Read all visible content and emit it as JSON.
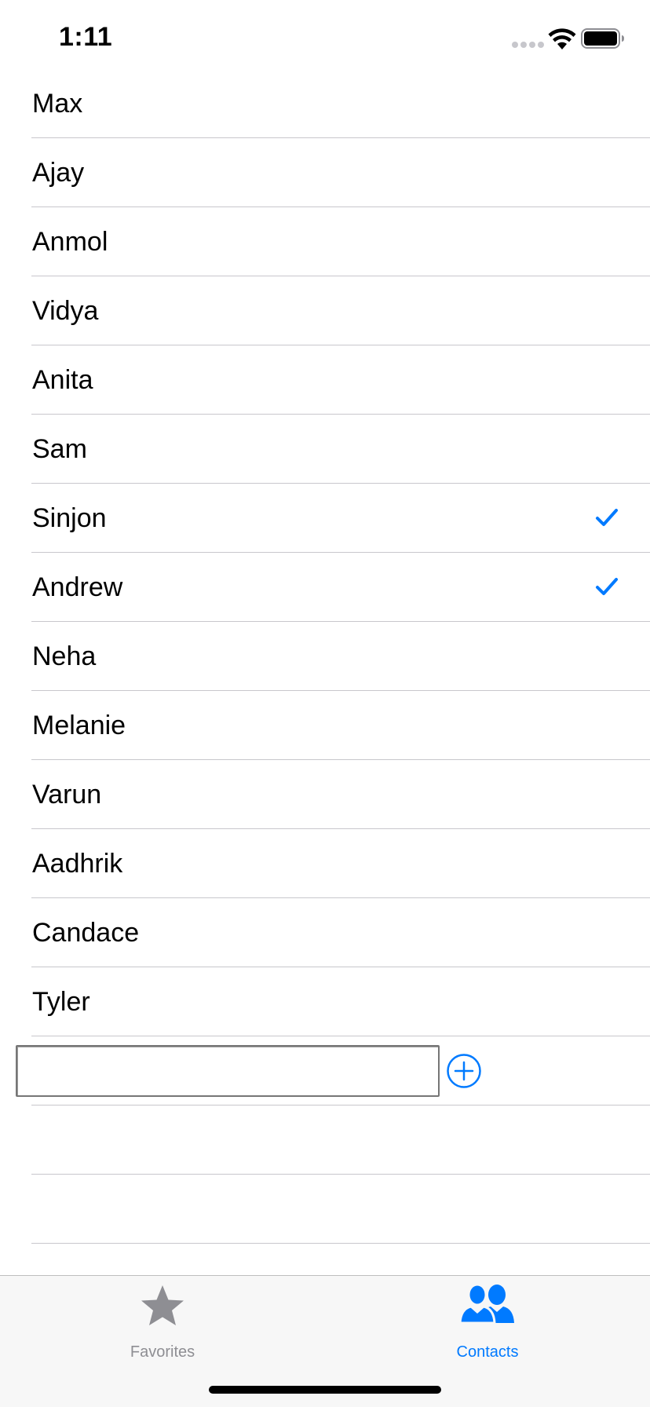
{
  "status_bar": {
    "time": "1:11"
  },
  "contacts": [
    {
      "name": "Max",
      "checked": false
    },
    {
      "name": "Ajay",
      "checked": false
    },
    {
      "name": "Anmol",
      "checked": false
    },
    {
      "name": "Vidya",
      "checked": false
    },
    {
      "name": "Anita",
      "checked": false
    },
    {
      "name": "Sam",
      "checked": false
    },
    {
      "name": "Sinjon",
      "checked": true
    },
    {
      "name": "Andrew",
      "checked": true
    },
    {
      "name": "Neha",
      "checked": false
    },
    {
      "name": "Melanie",
      "checked": false
    },
    {
      "name": "Varun",
      "checked": false
    },
    {
      "name": "Aadhrik",
      "checked": false
    },
    {
      "name": "Candace",
      "checked": false
    },
    {
      "name": "Tyler",
      "checked": false
    }
  ],
  "new_contact": {
    "value": "",
    "placeholder": ""
  },
  "tab_bar": {
    "tabs": [
      {
        "label": "Favorites",
        "icon": "star-icon",
        "active": false
      },
      {
        "label": "Contacts",
        "icon": "contacts-icon",
        "active": true
      }
    ]
  },
  "colors": {
    "accent": "#007aff",
    "inactive": "#8e8e93",
    "separator": "#c8c7cc",
    "tab_bar_bg": "#f7f7f7"
  }
}
